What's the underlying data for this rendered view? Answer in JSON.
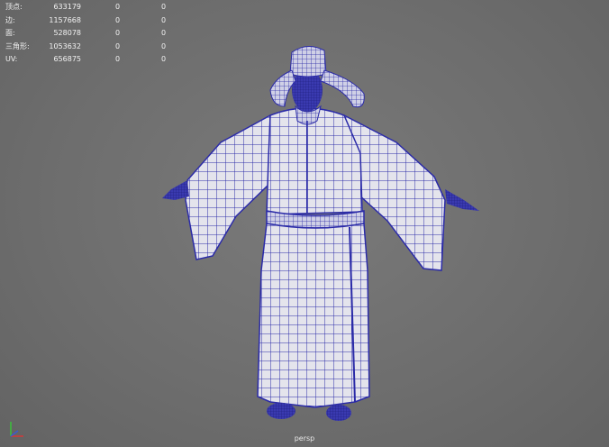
{
  "hud": {
    "rows": [
      {
        "label": "顶点:",
        "count": "633179",
        "selected": "0",
        "component": "0"
      },
      {
        "label": "边:",
        "count": "1157668",
        "selected": "0",
        "component": "0"
      },
      {
        "label": "面:",
        "count": "528078",
        "selected": "0",
        "component": "0"
      },
      {
        "label": "三角形:",
        "count": "1053632",
        "selected": "0",
        "component": "0"
      },
      {
        "label": "UV:",
        "count": "656875",
        "selected": "0",
        "component": "0"
      }
    ]
  },
  "viewport": {
    "camera_label": "persp",
    "background_color": "#6f6f6f",
    "wire_color": "#2b2ba8",
    "mesh_fill_color": "#e6e6ee"
  },
  "axis_gizmo": {
    "icon": "xyz-axis-icon",
    "x_color": "#d23a3a",
    "y_color": "#3ac23a",
    "z_color": "#3a5ad2"
  }
}
